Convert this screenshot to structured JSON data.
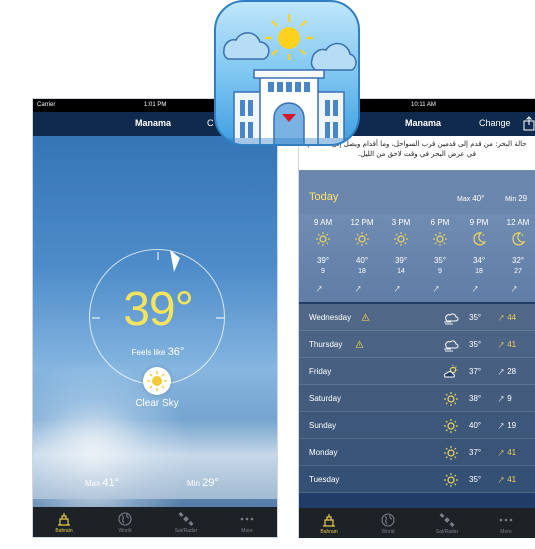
{
  "left_screen": {
    "status": {
      "carrier": "Carrier",
      "time": "1:01 PM"
    },
    "nav": {
      "city": "Manama",
      "right_partial": "C"
    },
    "current": {
      "temp": "39°",
      "feels_like_label": "Feels like",
      "feels_like_value": "36°",
      "condition": "Clear Sky",
      "max_label": "Max",
      "max_value": "41°",
      "min_label": "Min",
      "min_value": "29°"
    },
    "tabs": [
      {
        "label": "Bahrain",
        "icon": "bahrain-icon",
        "active": true
      },
      {
        "label": "World",
        "icon": "globe-icon",
        "active": false
      },
      {
        "label": "Sat/Radar",
        "icon": "satellite-icon",
        "active": false
      },
      {
        "label": "More",
        "icon": "more-icon",
        "active": false
      }
    ]
  },
  "right_screen": {
    "status": {
      "time": "10:11 AM"
    },
    "nav": {
      "city": "Manama",
      "change_label": "Change"
    },
    "sea_notice": "حالة البحر: من قدم إلى قدمين قرب السواحل، وما  أقدام ويصل إلى 6 أقدام في عرض البحر في وقت لاحق من  الليل.",
    "today": {
      "label": "Today",
      "max_label": "Max",
      "max_value": "40°",
      "min_label": "Min",
      "min_value": "29"
    },
    "hourly": [
      {
        "time": "9 AM",
        "icon": "sun-icon",
        "temp": "39°",
        "wind": "9"
      },
      {
        "time": "12 PM",
        "icon": "sun-icon",
        "temp": "40°",
        "wind": "18"
      },
      {
        "time": "3 PM",
        "icon": "sun-icon",
        "temp": "39°",
        "wind": "14"
      },
      {
        "time": "6 PM",
        "icon": "sun-icon",
        "temp": "35°",
        "wind": "9"
      },
      {
        "time": "9 PM",
        "icon": "moon-icon",
        "temp": "34°",
        "wind": "18"
      },
      {
        "time": "12 AM",
        "icon": "moon-icon",
        "temp": "32°",
        "wind": "27"
      }
    ],
    "daily": [
      {
        "day": "Wednesday",
        "warning": true,
        "icon": "dust-icon",
        "temp": "35°",
        "wind": "44",
        "wind_hot": true
      },
      {
        "day": "Thursday",
        "warning": true,
        "icon": "dust-icon",
        "temp": "35°",
        "wind": "41",
        "wind_hot": true
      },
      {
        "day": "Friday",
        "warning": false,
        "icon": "partly-cloudy-icon",
        "temp": "37°",
        "wind": "28",
        "wind_hot": false
      },
      {
        "day": "Saturday",
        "warning": false,
        "icon": "sun-icon",
        "temp": "38°",
        "wind": "9",
        "wind_hot": false
      },
      {
        "day": "Sunday",
        "warning": false,
        "icon": "sun-icon",
        "temp": "40°",
        "wind": "19",
        "wind_hot": false
      },
      {
        "day": "Monday",
        "warning": false,
        "icon": "sun-icon",
        "temp": "37°",
        "wind": "41",
        "wind_hot": true
      },
      {
        "day": "Tuesday",
        "warning": false,
        "icon": "sun-icon",
        "temp": "35°",
        "wind": "41",
        "wind_hot": true
      }
    ],
    "tabs": [
      {
        "label": "Bahrain",
        "icon": "bahrain-icon",
        "active": true
      },
      {
        "label": "World",
        "icon": "globe-icon",
        "active": false
      },
      {
        "label": "Sat/Radar",
        "icon": "satellite-icon",
        "active": false
      },
      {
        "label": "More",
        "icon": "more-icon",
        "active": false
      }
    ]
  },
  "colors": {
    "accent_yellow": "#f3e45b",
    "nav_dark": "#0f2a4c",
    "tabbar": "#1d2226",
    "hot_wind": "#f1d35a"
  }
}
